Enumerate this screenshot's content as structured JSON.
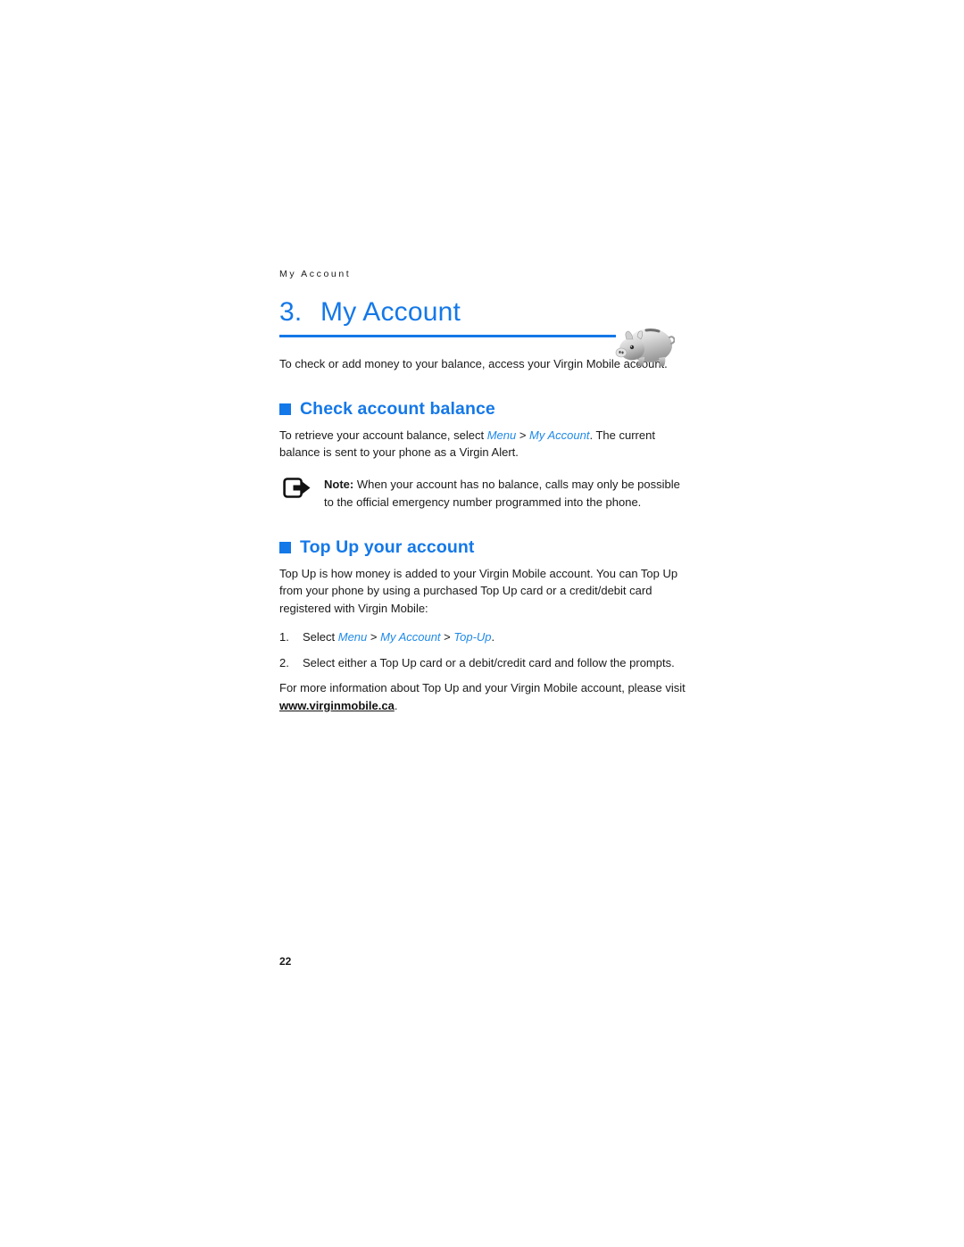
{
  "document": {
    "running_header": "My Account",
    "page_number": "22"
  },
  "chapter": {
    "number": "3.",
    "title": "My Account",
    "illustration_icon": "piggy-bank-icon",
    "intro": "To check or add money to your balance, access your Virgin Mobile account."
  },
  "sections": [
    {
      "bullet_icon": "square-bullet-icon",
      "title": "Check account balance",
      "body": {
        "lead": "To retrieve your account balance, select ",
        "link1": "Menu",
        "sep1": " > ",
        "link2": "My Account",
        "tail": ". The current balance is sent to your phone as a Virgin Alert."
      },
      "note": {
        "icon": "note-arrow-icon",
        "label": "Note:",
        "text": " When your account has no balance, calls may only be possible to the official emergency number programmed into the phone."
      }
    },
    {
      "bullet_icon": "square-bullet-icon",
      "title": "Top Up your account",
      "body": {
        "paragraph": "Top Up is how money is added to your Virgin Mobile account. You can Top Up from your phone by using a purchased Top Up card or a credit/debit card registered with Virgin Mobile:"
      },
      "steps": [
        {
          "number": "1.",
          "lead": "Select ",
          "link1": "Menu",
          "sep1": " > ",
          "link2": "My Account",
          "sep2": " > ",
          "link3": "Top-Up",
          "tail": "."
        },
        {
          "number": "2.",
          "text": "Select either a Top Up card or a debit/credit card and follow the prompts."
        }
      ],
      "closing": {
        "lead": "For more information about Top Up and your Virgin Mobile account, please visit ",
        "url": "www.virginmobile.ca",
        "tail": "."
      }
    }
  ],
  "colors": {
    "accent_blue": "#1478e8",
    "link_blue": "#1f8ae8",
    "body_text": "#1a1a1a"
  }
}
